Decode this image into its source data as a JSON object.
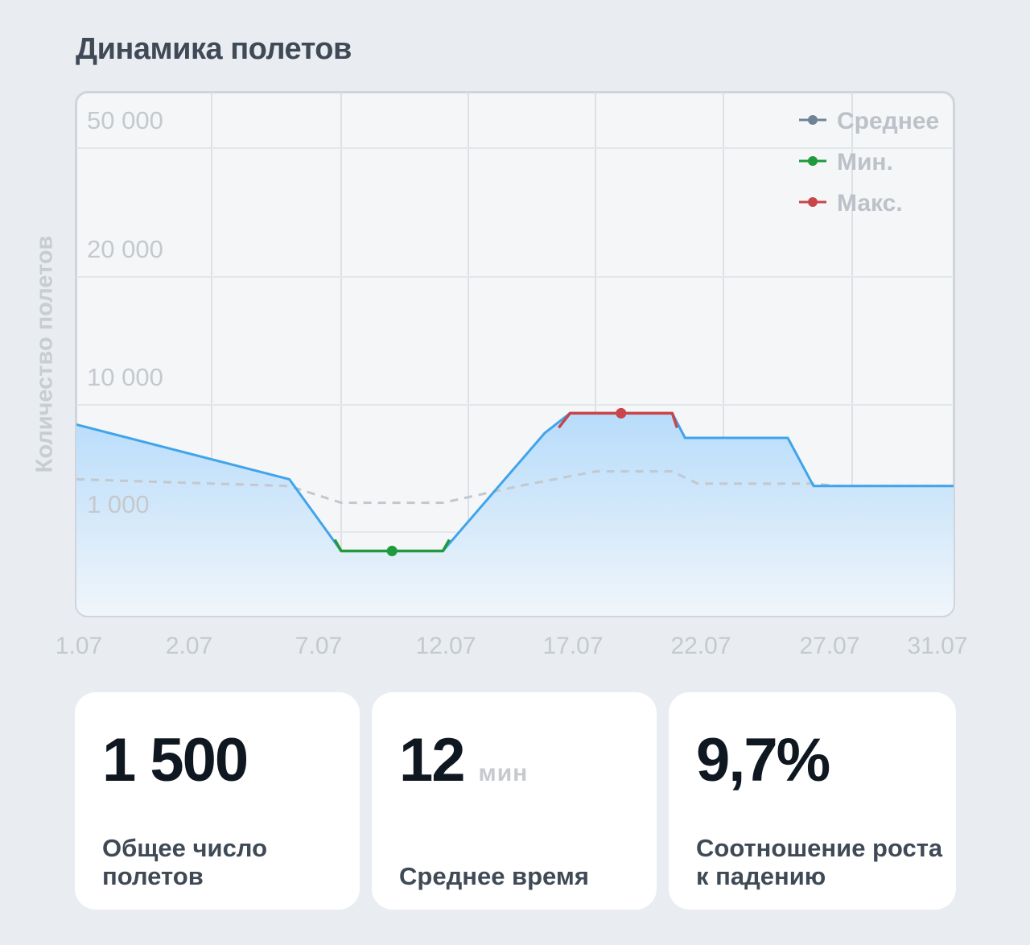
{
  "page": {
    "title": "Динамика полетов"
  },
  "chart_data": {
    "type": "area",
    "title": "Динамика полетов",
    "ylabel": "Количество полетов",
    "xlabel": "",
    "x_ticks": [
      "1.07",
      "2.07",
      "7.07",
      "12.07",
      "17.07",
      "22.07",
      "27.07",
      "31.07"
    ],
    "y_ticks": [
      {
        "value": 1000,
        "label": "1 000"
      },
      {
        "value": 10000,
        "label": "10 000"
      },
      {
        "value": 20000,
        "label": "20 000"
      },
      {
        "value": 50000,
        "label": "50 000"
      }
    ],
    "y_scale": "log",
    "ylim": [
      100,
      100000
    ],
    "grid": true,
    "legend": {
      "position": "top-right",
      "items": [
        {
          "name": "Среднее",
          "color": "#6e8496"
        },
        {
          "name": "Мин.",
          "color": "#1f9a3c"
        },
        {
          "name": "Макс.",
          "color": "#c8454a"
        }
      ]
    },
    "series": [
      {
        "name": "",
        "style": "solid",
        "color": "#41a4ea",
        "points": [
          {
            "x": "1.07",
            "y": 7000
          },
          {
            "x": "5.07",
            "y": 2600
          },
          {
            "x": "7.07",
            "y": 600
          },
          {
            "x": "11.07",
            "y": 600
          },
          {
            "x": "15.07",
            "y": 6000
          },
          {
            "x": "16.07",
            "y": 8600
          },
          {
            "x": "20.07",
            "y": 8600
          },
          {
            "x": "20.5",
            "y": 5500
          },
          {
            "x": "24.5",
            "y": 5500
          },
          {
            "x": "25.5",
            "y": 2300
          },
          {
            "x": "31.07",
            "y": 2300
          }
        ]
      },
      {
        "name": "Среднее",
        "style": "dashed",
        "color": "#c2c8ce",
        "points": [
          {
            "x": "1.07",
            "y": 2600
          },
          {
            "x": "5.07",
            "y": 2300
          },
          {
            "x": "7.07",
            "y": 1700
          },
          {
            "x": "11.07",
            "y": 1700
          },
          {
            "x": "14.07",
            "y": 2300
          },
          {
            "x": "17.07",
            "y": 3000
          },
          {
            "x": "20.07",
            "y": 3000
          },
          {
            "x": "21.07",
            "y": 2400
          },
          {
            "x": "25.5",
            "y": 2400
          },
          {
            "x": "26.5",
            "y": 2300
          },
          {
            "x": "31.07",
            "y": 2300
          }
        ]
      }
    ],
    "markers": [
      {
        "name": "Мин.",
        "x": "9.07",
        "y": 600,
        "color": "#1f9a3c"
      },
      {
        "name": "Макс.",
        "x": "18.07",
        "y": 8600,
        "color": "#c8454a"
      }
    ]
  },
  "stats": [
    {
      "value": "1 500",
      "unit": "",
      "label": "Общее число полетов"
    },
    {
      "value": "12",
      "unit": "мин",
      "label": "Среднее время"
    },
    {
      "value": "9,7%",
      "unit": "",
      "label": "Соотношение роста к падению"
    }
  ]
}
